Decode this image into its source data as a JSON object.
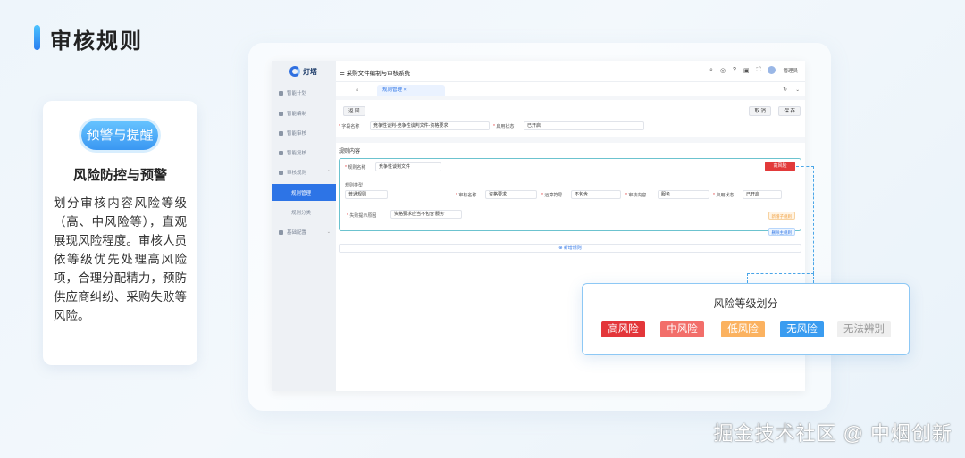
{
  "page": {
    "title": "审核规则"
  },
  "feature": {
    "badge": "预警与提醒",
    "heading": "风险防控与预警",
    "description": "划分审核内容风险等级（高、中风险等），直观展现风险程度。审核人员依等级优先处理高风险项，合理分配精力，预防供应商纠纷、采购失败等风险。"
  },
  "app": {
    "logo": "灯塔",
    "system_title": "采购文件编制与审核系统",
    "user_name": "管理员",
    "sidebar": {
      "items": [
        {
          "label": "智能计划"
        },
        {
          "label": "智能编制"
        },
        {
          "label": "智能审核"
        },
        {
          "label": "智能复核"
        },
        {
          "label": "审核规则"
        },
        {
          "label": "规则管理"
        },
        {
          "label": "规则分类"
        },
        {
          "label": "基础配置"
        }
      ]
    },
    "tabs": {
      "home": "⌂",
      "active": "规则管理"
    },
    "form": {
      "back_button": "返 回",
      "cancel_button": "取 消",
      "save_button": "保 存",
      "field_label": "字段名称",
      "field_value": "竞争性谈判-竞争性谈判文件-资格要求",
      "status_label": "启用状态",
      "status_value": "已开启"
    },
    "rule": {
      "section_title": "规则内容",
      "name_label": "规则名称",
      "name_value": "竞争性谈判文件",
      "risk_tag": "高风险",
      "type_label": "规则类型",
      "type_value": "普通规则",
      "audit_name_label": "审核名称",
      "audit_name_value": "资格要求",
      "operator_label": "运算符号",
      "operator_value": "不包含",
      "audit_content_label": "审核内容",
      "audit_content_value": "服务",
      "enable_label": "启用状态",
      "enable_value": "已开启",
      "hint_label": "失败提示原因",
      "hint_value": "资格要求应当不包含'服务'",
      "add_sub_button": "新增子规则",
      "delete_button": "删除主规则",
      "add_rule_button": "新增规则"
    }
  },
  "risk_levels": {
    "title": "风险等级划分",
    "levels": [
      {
        "label": "高风险",
        "bg": "#e3363a",
        "fg": "#ffffff"
      },
      {
        "label": "中风险",
        "bg": "#f26e6a",
        "fg": "#ffffff"
      },
      {
        "label": "低风险",
        "bg": "#fbb260",
        "fg": "#ffffff"
      },
      {
        "label": "无风险",
        "bg": "#3a9cf0",
        "fg": "#ffffff"
      },
      {
        "label": "无法辨别",
        "bg": "#efefef",
        "fg": "#999999"
      }
    ]
  },
  "watermark": "掘金技术社区 @ 中烟创新"
}
